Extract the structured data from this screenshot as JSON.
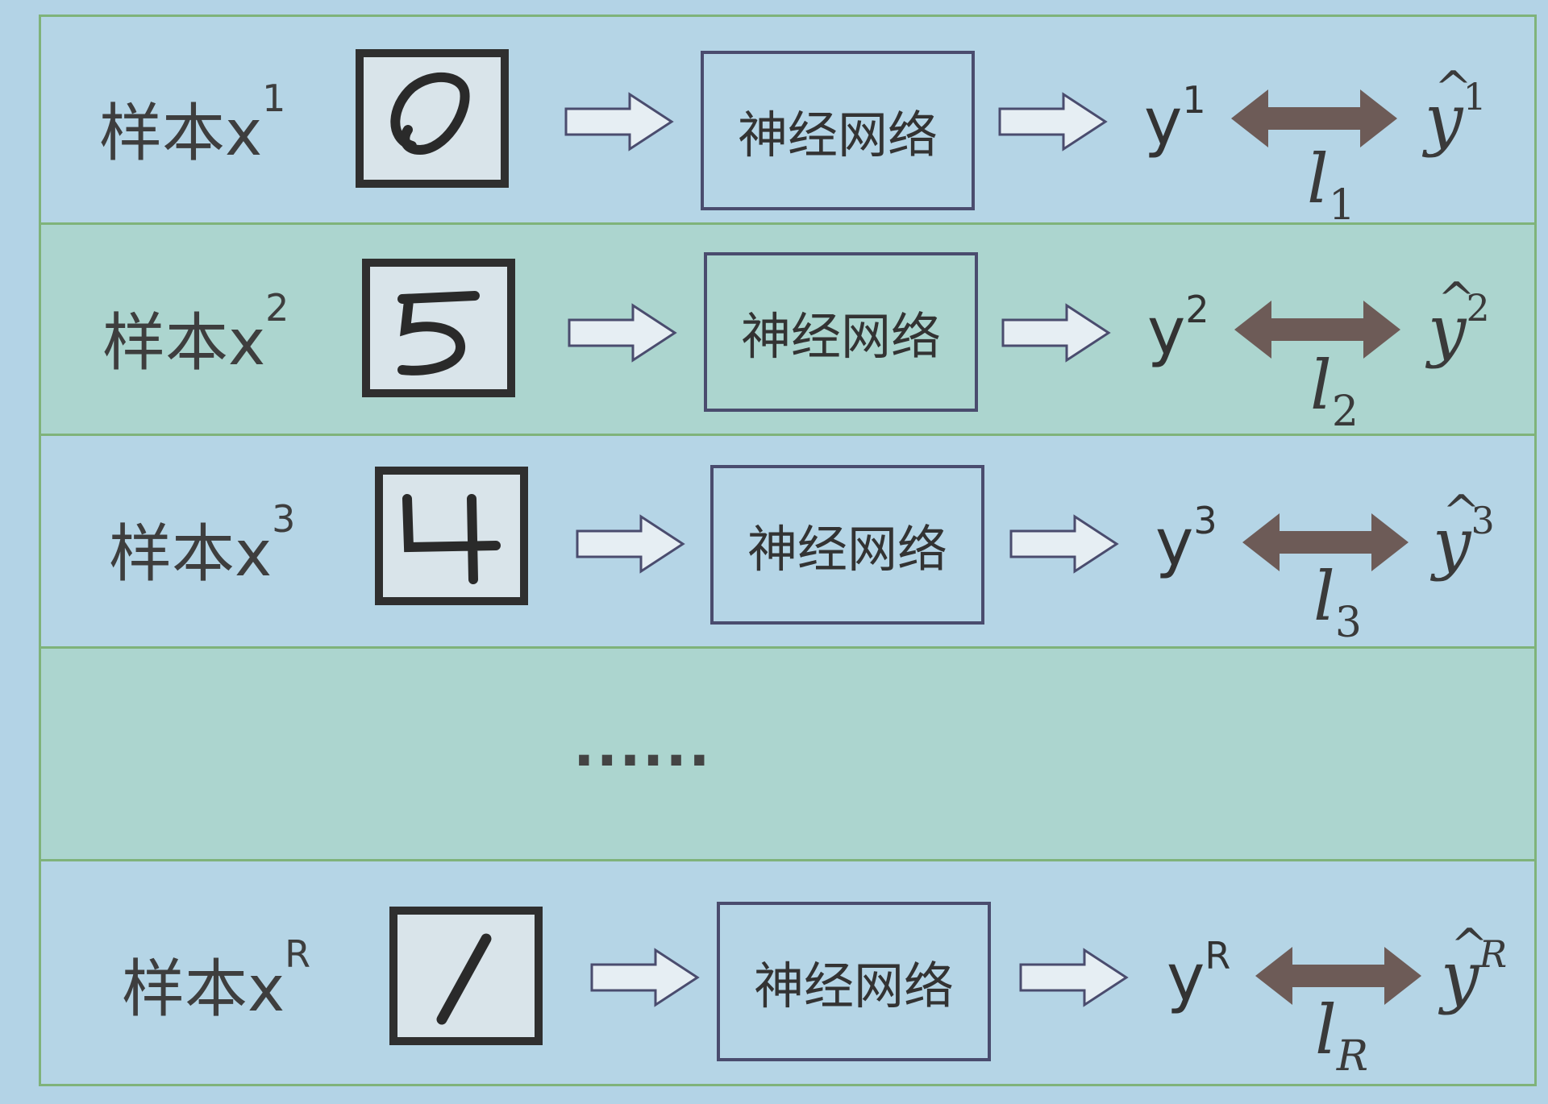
{
  "rows": [
    {
      "label": "样本x",
      "sup": "1",
      "nn": "神经网络",
      "y": "y",
      "y_sup": "1",
      "loss": "l",
      "loss_sub": "1",
      "yhat": "y",
      "yhat_sup": "1",
      "digit": "0"
    },
    {
      "label": "样本x",
      "sup": "2",
      "nn": "神经网络",
      "y": "y",
      "y_sup": "2",
      "loss": "l",
      "loss_sub": "2",
      "yhat": "y",
      "yhat_sup": "2",
      "digit": "5"
    },
    {
      "label": "样本x",
      "sup": "3",
      "nn": "神经网络",
      "y": "y",
      "y_sup": "3",
      "loss": "l",
      "loss_sub": "3",
      "yhat": "y",
      "yhat_sup": "3",
      "digit": "4"
    },
    {
      "label": "样本x",
      "sup": "R",
      "nn": "神经网络",
      "y": "y",
      "y_sup": "R",
      "loss": "l",
      "loss_sub": "R",
      "yhat": "y",
      "yhat_sup": "R",
      "digit": "1"
    }
  ],
  "ellipsis": "......",
  "hat_symbol": "^",
  "colors": {
    "border": "#7fb37a",
    "row_light": "#b5d5e6",
    "row_green": "#acd5cf",
    "arrow": "#6d5b57",
    "nn_border": "#4a4c6e"
  }
}
